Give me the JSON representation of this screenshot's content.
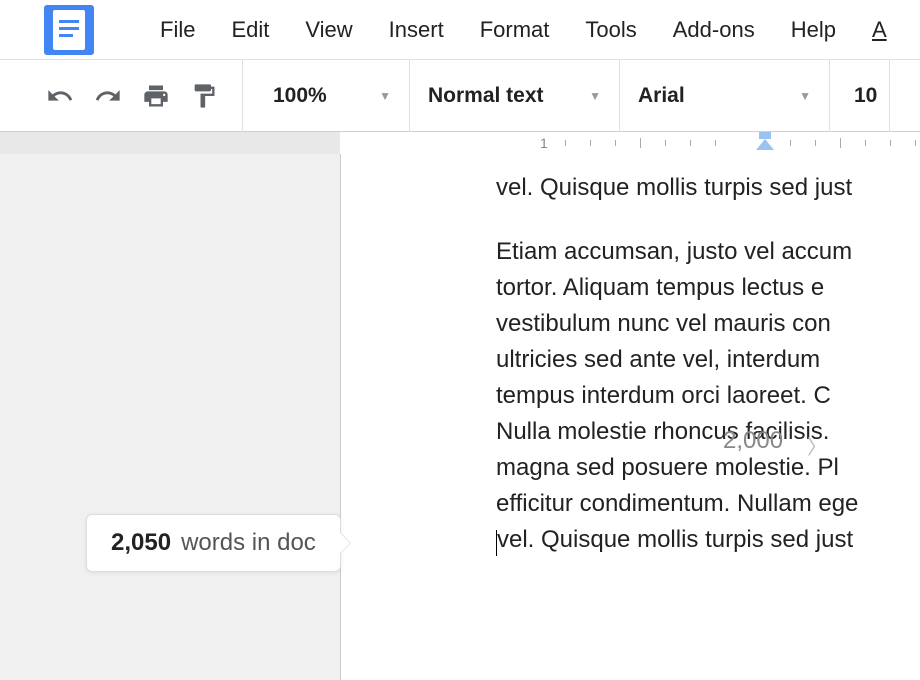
{
  "menubar": {
    "items": [
      "File",
      "Edit",
      "View",
      "Insert",
      "Format",
      "Tools",
      "Add-ons",
      "Help"
    ],
    "cut_item": "A"
  },
  "toolbar": {
    "zoom": "100%",
    "paragraph_style": "Normal text",
    "font": "Arial",
    "font_size": "10"
  },
  "ruler": {
    "number": "1"
  },
  "document": {
    "line_top": "vel. Quisque mollis turpis sed just",
    "para_lines": [
      "Etiam accumsan, justo vel accum",
      "tortor.  Aliquam  tempus  lectus  e",
      "vestibulum  nunc  vel  mauris  con",
      "ultricies  sed  ante  vel,  interdum ",
      "tempus  interdum  orci  laoreet.  C",
      "Nulla  molestie  rhoncus  facilisis. ",
      "magna  sed  posuere  molestie.  Pl",
      "efficitur condimentum. Nullam ege",
      "vel. Quisque mollis turpis sed just"
    ],
    "line_number_label": "2,000"
  },
  "word_count": {
    "count": "2,050",
    "label": "words in doc"
  }
}
